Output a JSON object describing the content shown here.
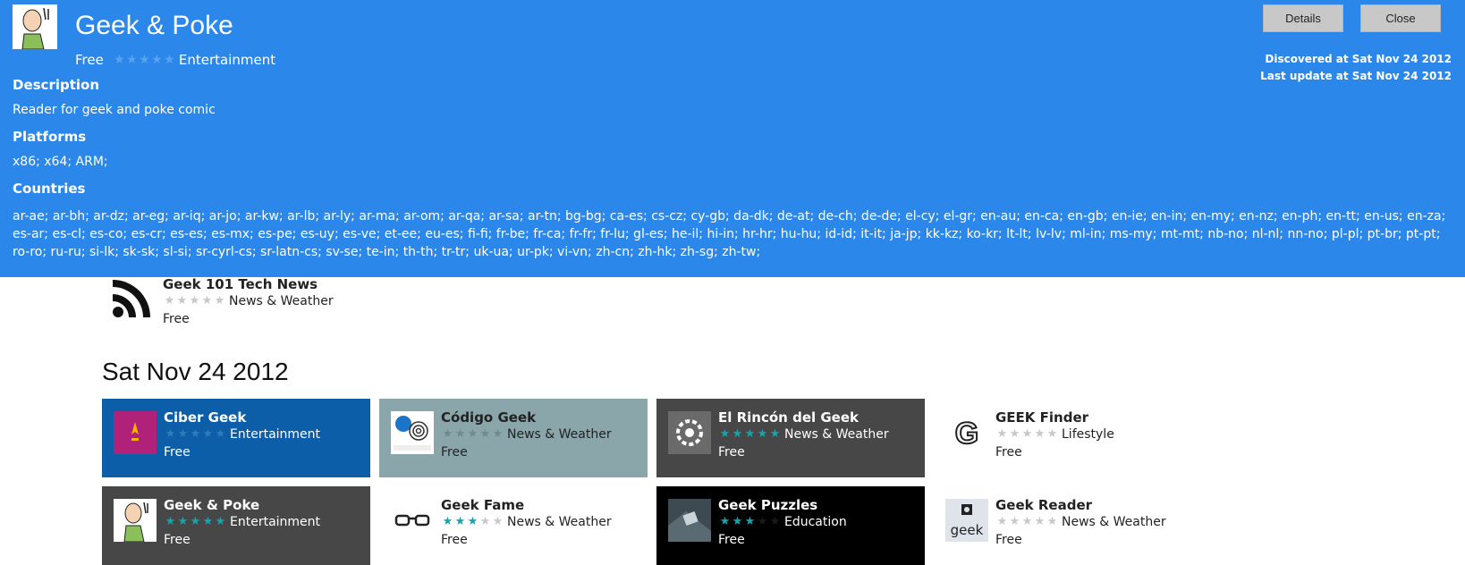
{
  "overlay": {
    "title": "Geek & Poke",
    "price": "Free",
    "category": "Entertainment",
    "rating": 0,
    "details_button": "Details",
    "close_button": "Close",
    "discovered": "Discovered at Sat Nov 24 2012",
    "last_update": "Last update at Sat Nov 24 2012",
    "description_heading": "Description",
    "description": "Reader for geek and poke comic",
    "platforms_heading": "Platforms",
    "platforms": "x86; x64; ARM;",
    "countries_heading": "Countries",
    "countries": "ar-ae; ar-bh; ar-dz; ar-eg; ar-iq; ar-jo; ar-kw; ar-lb; ar-ly; ar-ma; ar-om; ar-qa; ar-sa; ar-tn; bg-bg; ca-es; cs-cz; cy-gb; da-dk; de-at; de-ch; de-de; el-cy; el-gr; en-au; en-ca; en-gb; en-ie; en-in; en-my; en-nz; en-ph; en-tt; en-us; en-za; es-ar; es-cl; es-co; es-cr; es-es; es-mx; es-pe; es-uy; es-ve; et-ee; eu-es; fi-fi; fr-be; fr-ca; fr-fr; fr-lu; gl-es; he-il; hi-in; hr-hr; hu-hu; id-id; it-it; ja-jp; kk-kz; ko-kr; lt-lt; lv-lv; ml-in; ms-my; mt-mt; nb-no; nl-nl; nn-no; pl-pl; pt-br; pt-pt; ro-ro; ru-ru; si-lk; sk-sk; sl-si; sr-cyrl-cs; sr-latn-cs; sv-se; te-in; th-th; tr-tr; uk-ua; ur-pk; vi-vn; zh-cn; zh-hk; zh-sg; zh-tw;"
  },
  "previous_item": {
    "name": "Geek 101 Tech News",
    "category": "News & Weather",
    "price": "Free",
    "rating": 0,
    "icon": "rss-icon"
  },
  "date_heading": "Sat Nov 24 2012",
  "tiles": [
    {
      "name": "Ciber Geek",
      "category": "Entertainment",
      "price": "Free",
      "rating": 0,
      "bg": "#0d5ea8",
      "theme": "dark",
      "icon": "star-badge-icon"
    },
    {
      "name": "Código Geek",
      "category": "News & Weather",
      "price": "Free",
      "rating": 0,
      "bg": "#8aa6ab",
      "theme": "light",
      "icon": "fingerprint-icon"
    },
    {
      "name": "El Rincón del Geek",
      "category": "News & Weather",
      "price": "Free",
      "rating": 5,
      "bg": "#474747",
      "theme": "dark",
      "icon": "gear-icon"
    },
    {
      "name": "GEEK Finder",
      "category": "Lifestyle",
      "price": "Free",
      "rating": 0,
      "bg": "#ffffff",
      "theme": "light",
      "icon": "g-letter-icon"
    },
    {
      "name": "Geek & Poke",
      "category": "Entertainment",
      "price": "Free",
      "rating": 5,
      "bg": "#474747",
      "theme": "dark",
      "icon": "cartoon-man-icon"
    },
    {
      "name": "Geek Fame",
      "category": "News & Weather",
      "price": "Free",
      "rating": 3,
      "bg": "#ffffff",
      "theme": "light",
      "icon": "glasses-icon"
    },
    {
      "name": "Geek Puzzles",
      "category": "Education",
      "price": "Free",
      "rating": 3,
      "bg": "#000000",
      "theme": "dark",
      "icon": "puzzle-icon"
    },
    {
      "name": "Geek Reader",
      "category": "News & Weather",
      "price": "Free",
      "rating": 0,
      "bg": "#ffffff",
      "theme": "light",
      "icon": "geek-logo-icon"
    }
  ],
  "colors": {
    "overlay_bg": "#2b87ea",
    "star_filled": "#1aa3a8",
    "star_empty_dark": "#2f7db8",
    "star_empty_light": "#c8c8c8"
  }
}
